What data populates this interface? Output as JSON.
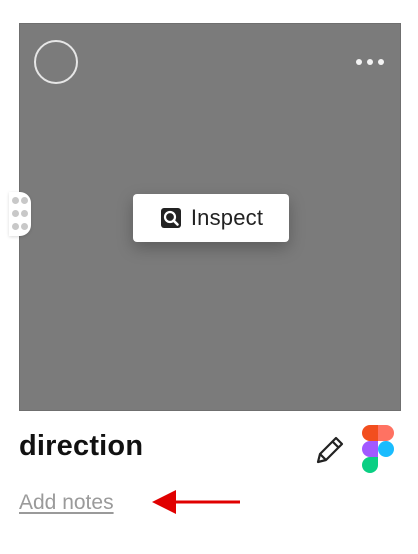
{
  "card": {
    "background": "#7b7b7b",
    "inspect_label": "Inspect",
    "inspect_icon": "inspect-icon",
    "more_icon": "more-horizontal-icon",
    "select_icon": "select-circle-icon",
    "drag_icon": "drag-handle-icon"
  },
  "item": {
    "title": "direction",
    "add_notes_label": "Add notes",
    "edit_icon": "pencil-icon",
    "app_icon": "figma-logo"
  },
  "annotation": {
    "arrow_color": "#e00000"
  }
}
